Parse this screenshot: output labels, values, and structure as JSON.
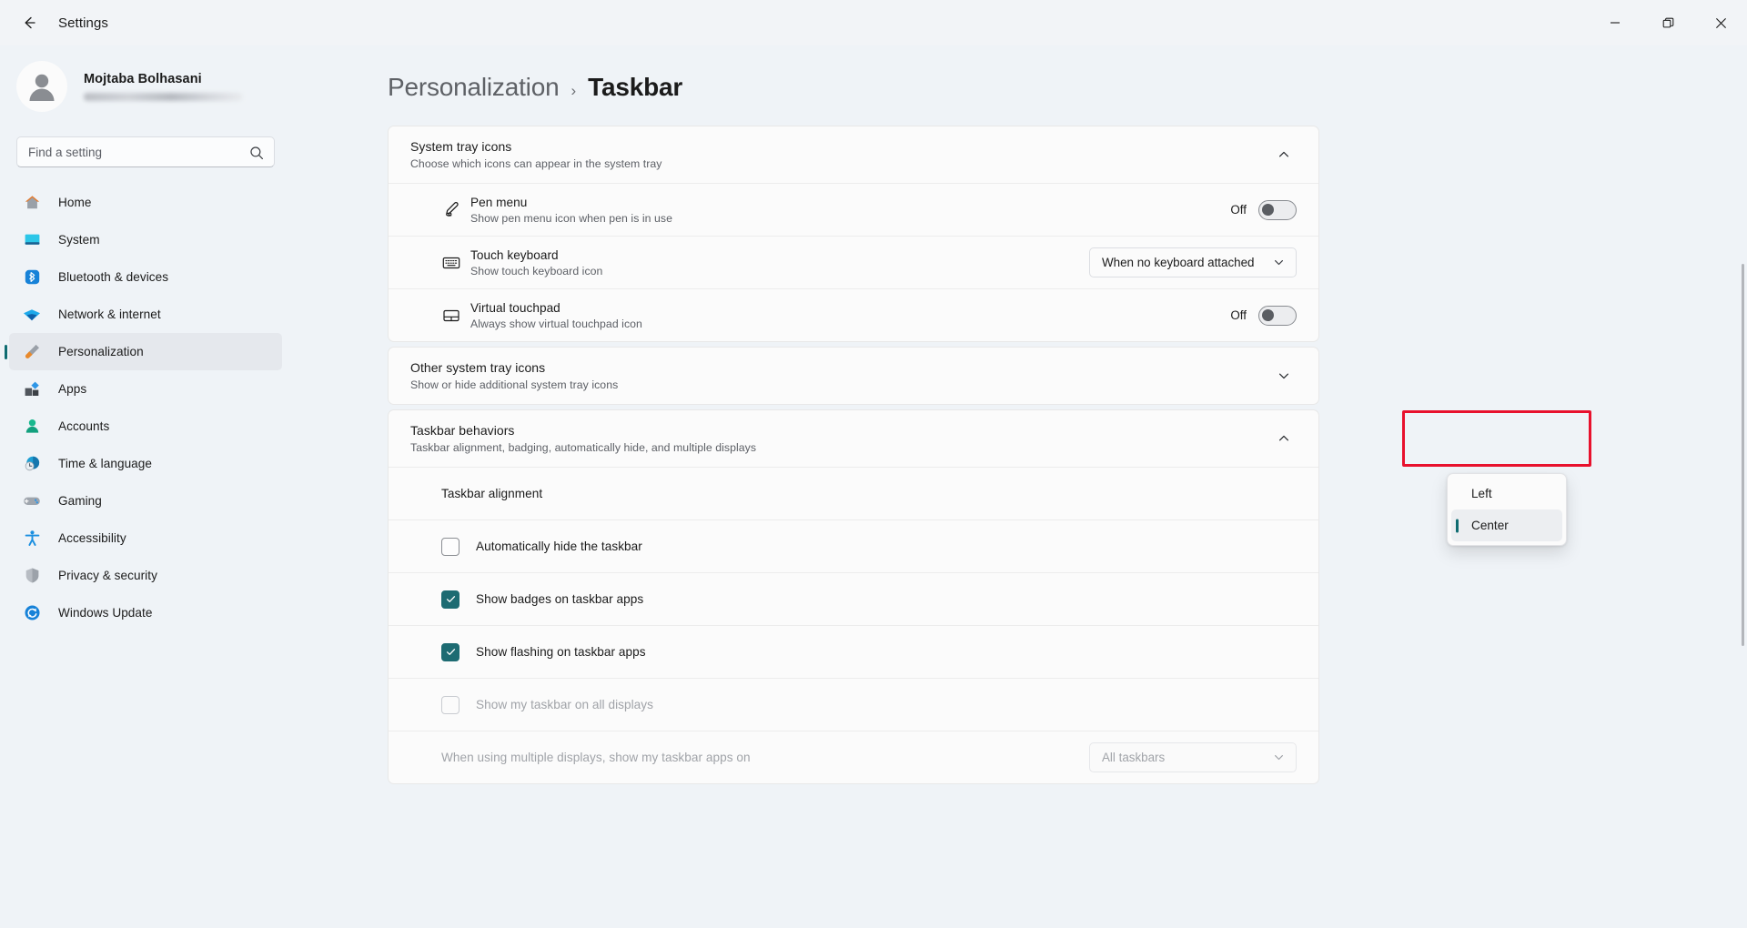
{
  "window": {
    "title": "Settings",
    "back_icon": "back-arrow-icon",
    "controls": [
      {
        "name": "minimize",
        "glyph": "minimize-icon"
      },
      {
        "name": "restore",
        "glyph": "restore-icon"
      },
      {
        "name": "close",
        "glyph": "close-icon"
      }
    ]
  },
  "sidebar": {
    "profile": {
      "name": "Mojtaba Bolhasani",
      "email_redacted": true,
      "avatar_icon": "person-avatar-icon"
    },
    "search": {
      "placeholder": "Find a setting",
      "value": "",
      "icon": "search-icon"
    },
    "items": [
      {
        "label": "Home",
        "icon": "home-icon",
        "active": false
      },
      {
        "label": "System",
        "icon": "system-display-icon",
        "active": false
      },
      {
        "label": "Bluetooth & devices",
        "icon": "bluetooth-icon",
        "active": false
      },
      {
        "label": "Network & internet",
        "icon": "wifi-icon",
        "active": false
      },
      {
        "label": "Personalization",
        "icon": "paintbrush-icon",
        "active": true
      },
      {
        "label": "Apps",
        "icon": "apps-icon",
        "active": false
      },
      {
        "label": "Accounts",
        "icon": "accounts-person-icon",
        "active": false
      },
      {
        "label": "Time & language",
        "icon": "clock-globe-icon",
        "active": false
      },
      {
        "label": "Gaming",
        "icon": "gamepad-icon",
        "active": false
      },
      {
        "label": "Accessibility",
        "icon": "accessibility-icon",
        "active": false
      },
      {
        "label": "Privacy & security",
        "icon": "shield-icon",
        "active": false
      },
      {
        "label": "Windows Update",
        "icon": "update-refresh-icon",
        "active": false
      }
    ]
  },
  "breadcrumb": {
    "parent": "Personalization",
    "separator": "›",
    "current": "Taskbar"
  },
  "cards": {
    "system_tray": {
      "title": "System tray icons",
      "subtitle": "Choose which icons can appear in the system tray",
      "expanded": true,
      "chevron": "chevron-up-icon",
      "rows": [
        {
          "title": "Pen menu",
          "subtitle": "Show pen menu icon when pen is in use",
          "icon": "pen-icon",
          "control": "toggle",
          "toggle_label": "Off",
          "toggle_on": false
        },
        {
          "title": "Touch keyboard",
          "subtitle": "Show touch keyboard icon",
          "icon": "keyboard-icon",
          "control": "combo",
          "combo_value": "When no keyboard attached"
        },
        {
          "title": "Virtual touchpad",
          "subtitle": "Always show virtual touchpad icon",
          "icon": "touchpad-icon",
          "control": "toggle",
          "toggle_label": "Off",
          "toggle_on": false
        }
      ]
    },
    "other_tray": {
      "title": "Other system tray icons",
      "subtitle": "Show or hide additional system tray icons",
      "expanded": false,
      "chevron": "chevron-down-icon"
    },
    "taskbar_behaviors": {
      "title": "Taskbar behaviors",
      "subtitle": "Taskbar alignment, badging, automatically hide, and multiple displays",
      "expanded": true,
      "chevron": "chevron-up-icon",
      "alignment_row": {
        "label": "Taskbar alignment"
      },
      "checkboxes": [
        {
          "label": "Automatically hide the taskbar",
          "checked": false,
          "disabled": false
        },
        {
          "label": "Show badges on taskbar apps",
          "checked": true,
          "disabled": false
        },
        {
          "label": "Show flashing on taskbar apps",
          "checked": true,
          "disabled": false
        },
        {
          "label": "Show my taskbar on all displays",
          "checked": false,
          "disabled": true
        }
      ],
      "multi_display_row": {
        "label": "When using multiple displays, show my taskbar apps on",
        "combo_value": "All taskbars",
        "disabled": true
      }
    }
  },
  "dropdown_flyout": {
    "open": true,
    "options": [
      {
        "label": "Left",
        "selected": false
      },
      {
        "label": "Center",
        "selected": true
      }
    ]
  },
  "annotation": {
    "shape": "rectangle",
    "color": "#e8112d",
    "targets": "Left"
  },
  "colors": {
    "accent_teal": "#0f6c71",
    "checkbox_teal": "#1d6b72",
    "annotation_red": "#e8112d",
    "page_bg": "#eff3f7",
    "card_bg": "#fbfbfb"
  }
}
